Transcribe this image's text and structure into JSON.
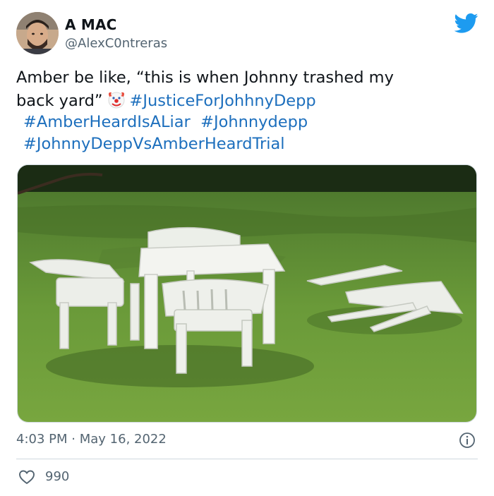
{
  "author": {
    "name": "A MAC",
    "handle": "@AlexC0ntreras"
  },
  "tweet": {
    "line1": "Amber be like, “this is when Johnny trashed my",
    "line2_text": "back yard”",
    "emoji": "clown-face",
    "hashtags": [
      "#JusticeForJohhnyDepp",
      "#AmberHeardIsALiar",
      "#Johnnydepp",
      "#JohnnyDeppVsAmberHeardTrial"
    ]
  },
  "media": {
    "description_icon": "photo-of-garden-furniture"
  },
  "meta": {
    "time": "4:03 PM",
    "separator": "·",
    "date": "May 16, 2022"
  },
  "stats": {
    "likes": "990"
  },
  "icons": {
    "brand": "twitter-bird-icon",
    "info": "info-icon",
    "like": "heart-icon"
  },
  "colors": {
    "link": "#1d6fbd",
    "brand": "#1d9bf0",
    "secondary_text": "#536471",
    "primary_text": "#0f1419"
  }
}
